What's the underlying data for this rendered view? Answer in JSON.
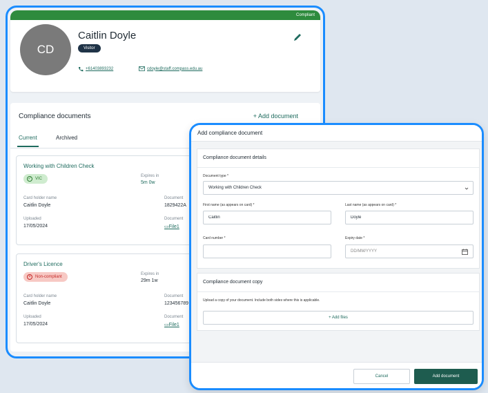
{
  "colors": {
    "accent": "#1e6b5e",
    "compliant": "#2e8b3d",
    "window_border": "#1a8cff",
    "primary_button": "#1e5c4f",
    "non_compliant_bg": "#f7c9c4"
  },
  "profile": {
    "status_banner": "Compliant",
    "initials": "CD",
    "name": "Caitlin Doyle",
    "role_badge": "Visitor",
    "phone": "+61403893232",
    "email": "cdoyle@staff.compass.edu.au",
    "icons": [
      "pencil-icon",
      "phone-icon",
      "mail-icon"
    ]
  },
  "compliance": {
    "title": "Compliance documents",
    "add_label": "+ Add document",
    "tabs": [
      {
        "label": "Current",
        "active": true
      },
      {
        "label": "Archived",
        "active": false
      }
    ],
    "documents": [
      {
        "title": "Working with Children Check",
        "status": "VIC",
        "status_kind": "ok",
        "expires_label": "Expires in",
        "expires_value": "5m 0w",
        "holder_label": "Card holder name",
        "holder_value": "Caitlin Doyle",
        "number_label": "Document",
        "number_value": "1829422A",
        "uploaded_label": "Uploaded",
        "uploaded_value": "17/05/2024",
        "file_label": "Document",
        "file_link": "File1"
      },
      {
        "title": "Driver's Licence",
        "status": "Non-compliant",
        "status_kind": "bad",
        "expires_label": "Expires in",
        "expires_value": "29m 1w",
        "holder_label": "Card holder name",
        "holder_value": "Caitlin Doyle",
        "number_label": "Document",
        "number_value": "123456789",
        "uploaded_label": "Uploaded",
        "uploaded_value": "17/05/2024",
        "file_label": "Document",
        "file_link": "File1"
      }
    ]
  },
  "modal": {
    "title": "Add compliance document",
    "details_section": "Compliance document details",
    "document_type_label": "Document type *",
    "document_type_value": "Working with Children Check",
    "first_name_label": "First name (as appears on card) *",
    "first_name_value": "Caitlin",
    "last_name_label": "Last name (as appears on card) *",
    "last_name_value": "Doyle",
    "card_number_label": "Card number *",
    "card_number_value": "",
    "expiry_label": "Expiry date *",
    "expiry_placeholder": "DD/MM/YYYY",
    "copy_section": "Compliance document copy",
    "upload_hint": "Upload a copy of your document. Include both sides where this is applicable.",
    "add_files": "+ Add files",
    "cancel": "Cancel",
    "submit": "Add document"
  }
}
